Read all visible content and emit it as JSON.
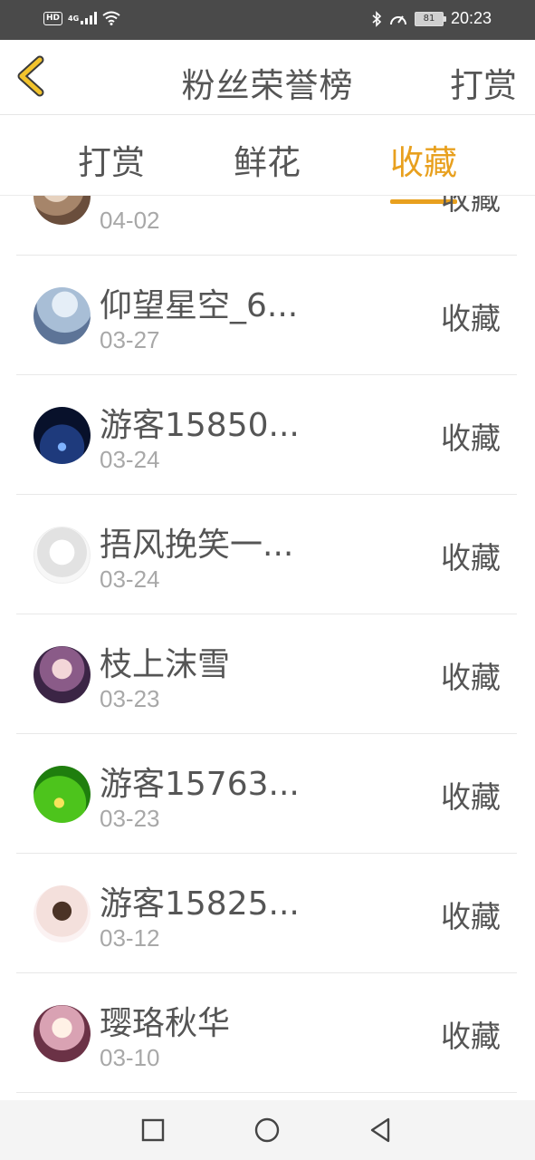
{
  "status_bar": {
    "left_badges": [
      "HD",
      "4G"
    ],
    "icons": [
      "signal-icon",
      "wifi-icon",
      "bluetooth-icon",
      "speed-icon",
      "battery-icon"
    ],
    "battery_level": "81",
    "time": "20:23"
  },
  "header": {
    "back_icon": "chevron-left-icon",
    "title": "粉丝荣誉榜",
    "action_label": "打赏"
  },
  "tabs": [
    {
      "label": "打赏",
      "active": false
    },
    {
      "label": "鲜花",
      "active": false
    },
    {
      "label": "收藏",
      "active": true
    }
  ],
  "list": {
    "items": [
      {
        "name": "",
        "date": "04-02",
        "action": "收藏"
      },
      {
        "name": "仰望星空_6...",
        "date": "03-27",
        "action": "收藏"
      },
      {
        "name": "游客15850...",
        "date": "03-24",
        "action": "收藏"
      },
      {
        "name": "捂风挽笑一...",
        "date": "03-24",
        "action": "收藏"
      },
      {
        "name": "枝上沫雪",
        "date": "03-23",
        "action": "收藏"
      },
      {
        "name": "游客15763...",
        "date": "03-23",
        "action": "收藏"
      },
      {
        "name": "游客15825...",
        "date": "03-12",
        "action": "收藏"
      },
      {
        "name": "璎珞秋华",
        "date": "03-10",
        "action": "收藏"
      }
    ]
  },
  "colors": {
    "accent": "#e8a01e",
    "text": "#555555",
    "muted": "#a8a8a8",
    "status_bar_bg": "#4a4a4a"
  },
  "nav_bar": {
    "buttons": [
      "recent-apps-icon",
      "home-icon",
      "back-triangle-icon"
    ]
  }
}
